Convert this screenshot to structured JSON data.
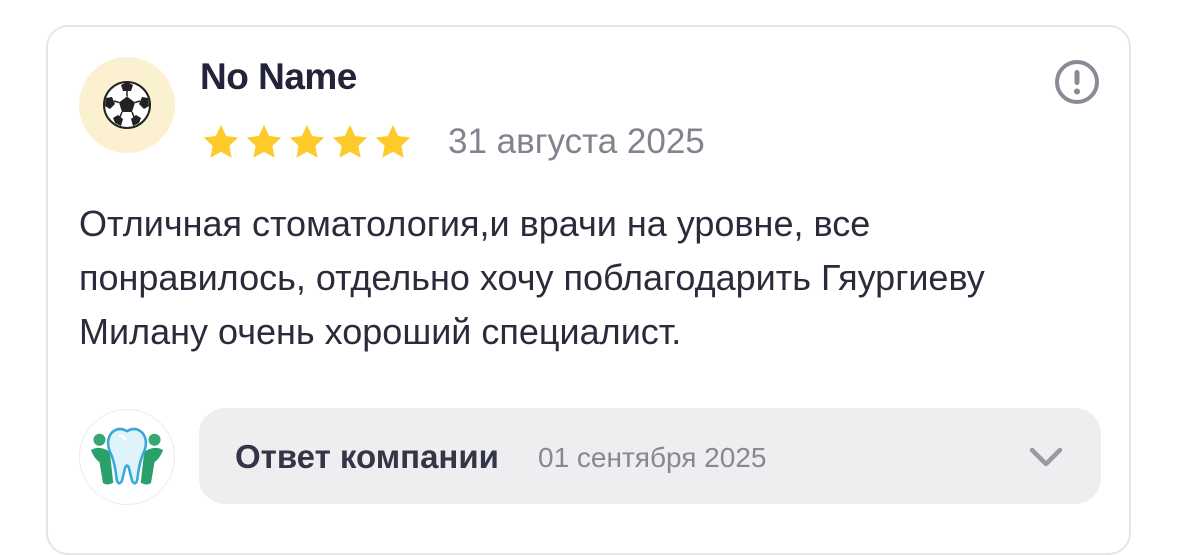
{
  "review": {
    "author_name": "No Name",
    "avatar_icon": "soccer-ball-icon",
    "rating": 5,
    "rating_max": 5,
    "star_color": "#fccb2a",
    "date": "31 августа 2025",
    "text": "Отличная стоматология,и врачи на уровне, все понравилось, отдельно хочу поблагодарить Гяургиеву Милану очень хороший специалист.",
    "report_icon": "exclamation-circle-icon"
  },
  "company_reply": {
    "logo_icon": "tooth-logo-icon",
    "title": "Ответ компании",
    "date": "01 сентября 2025",
    "expand_icon": "chevron-down-icon"
  }
}
